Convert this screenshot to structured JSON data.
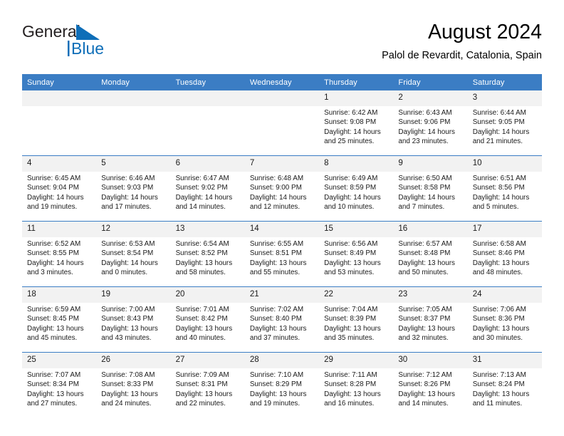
{
  "brand": {
    "name_line1": "General",
    "name_line2": "Blue",
    "logo_icon": "triangle-flag-icon",
    "color_dark": "#231f20",
    "color_blue": "#0e6eb8"
  },
  "header": {
    "title": "August 2024",
    "subtitle": "Palol de Revardit, Catalonia, Spain"
  },
  "theme": {
    "header_bg": "#3b7dc4",
    "header_text": "#ffffff",
    "daynum_bg": "#f2f2f2",
    "cell_bg": "#ffffff",
    "row_divider": "#3b7dc4",
    "body_text": "#1a1a1a"
  },
  "calendar": {
    "columns": [
      "Sunday",
      "Monday",
      "Tuesday",
      "Wednesday",
      "Thursday",
      "Friday",
      "Saturday"
    ],
    "weeks": [
      [
        {
          "day": "",
          "empty": true,
          "sunrise": "",
          "sunset": "",
          "daylight1": "",
          "daylight2": ""
        },
        {
          "day": "",
          "empty": true,
          "sunrise": "",
          "sunset": "",
          "daylight1": "",
          "daylight2": ""
        },
        {
          "day": "",
          "empty": true,
          "sunrise": "",
          "sunset": "",
          "daylight1": "",
          "daylight2": ""
        },
        {
          "day": "",
          "empty": true,
          "sunrise": "",
          "sunset": "",
          "daylight1": "",
          "daylight2": ""
        },
        {
          "day": "1",
          "empty": false,
          "sunrise": "Sunrise: 6:42 AM",
          "sunset": "Sunset: 9:08 PM",
          "daylight1": "Daylight: 14 hours",
          "daylight2": "and 25 minutes."
        },
        {
          "day": "2",
          "empty": false,
          "sunrise": "Sunrise: 6:43 AM",
          "sunset": "Sunset: 9:06 PM",
          "daylight1": "Daylight: 14 hours",
          "daylight2": "and 23 minutes."
        },
        {
          "day": "3",
          "empty": false,
          "sunrise": "Sunrise: 6:44 AM",
          "sunset": "Sunset: 9:05 PM",
          "daylight1": "Daylight: 14 hours",
          "daylight2": "and 21 minutes."
        }
      ],
      [
        {
          "day": "4",
          "empty": false,
          "sunrise": "Sunrise: 6:45 AM",
          "sunset": "Sunset: 9:04 PM",
          "daylight1": "Daylight: 14 hours",
          "daylight2": "and 19 minutes."
        },
        {
          "day": "5",
          "empty": false,
          "sunrise": "Sunrise: 6:46 AM",
          "sunset": "Sunset: 9:03 PM",
          "daylight1": "Daylight: 14 hours",
          "daylight2": "and 17 minutes."
        },
        {
          "day": "6",
          "empty": false,
          "sunrise": "Sunrise: 6:47 AM",
          "sunset": "Sunset: 9:02 PM",
          "daylight1": "Daylight: 14 hours",
          "daylight2": "and 14 minutes."
        },
        {
          "day": "7",
          "empty": false,
          "sunrise": "Sunrise: 6:48 AM",
          "sunset": "Sunset: 9:00 PM",
          "daylight1": "Daylight: 14 hours",
          "daylight2": "and 12 minutes."
        },
        {
          "day": "8",
          "empty": false,
          "sunrise": "Sunrise: 6:49 AM",
          "sunset": "Sunset: 8:59 PM",
          "daylight1": "Daylight: 14 hours",
          "daylight2": "and 10 minutes."
        },
        {
          "day": "9",
          "empty": false,
          "sunrise": "Sunrise: 6:50 AM",
          "sunset": "Sunset: 8:58 PM",
          "daylight1": "Daylight: 14 hours",
          "daylight2": "and 7 minutes."
        },
        {
          "day": "10",
          "empty": false,
          "sunrise": "Sunrise: 6:51 AM",
          "sunset": "Sunset: 8:56 PM",
          "daylight1": "Daylight: 14 hours",
          "daylight2": "and 5 minutes."
        }
      ],
      [
        {
          "day": "11",
          "empty": false,
          "sunrise": "Sunrise: 6:52 AM",
          "sunset": "Sunset: 8:55 PM",
          "daylight1": "Daylight: 14 hours",
          "daylight2": "and 3 minutes."
        },
        {
          "day": "12",
          "empty": false,
          "sunrise": "Sunrise: 6:53 AM",
          "sunset": "Sunset: 8:54 PM",
          "daylight1": "Daylight: 14 hours",
          "daylight2": "and 0 minutes."
        },
        {
          "day": "13",
          "empty": false,
          "sunrise": "Sunrise: 6:54 AM",
          "sunset": "Sunset: 8:52 PM",
          "daylight1": "Daylight: 13 hours",
          "daylight2": "and 58 minutes."
        },
        {
          "day": "14",
          "empty": false,
          "sunrise": "Sunrise: 6:55 AM",
          "sunset": "Sunset: 8:51 PM",
          "daylight1": "Daylight: 13 hours",
          "daylight2": "and 55 minutes."
        },
        {
          "day": "15",
          "empty": false,
          "sunrise": "Sunrise: 6:56 AM",
          "sunset": "Sunset: 8:49 PM",
          "daylight1": "Daylight: 13 hours",
          "daylight2": "and 53 minutes."
        },
        {
          "day": "16",
          "empty": false,
          "sunrise": "Sunrise: 6:57 AM",
          "sunset": "Sunset: 8:48 PM",
          "daylight1": "Daylight: 13 hours",
          "daylight2": "and 50 minutes."
        },
        {
          "day": "17",
          "empty": false,
          "sunrise": "Sunrise: 6:58 AM",
          "sunset": "Sunset: 8:46 PM",
          "daylight1": "Daylight: 13 hours",
          "daylight2": "and 48 minutes."
        }
      ],
      [
        {
          "day": "18",
          "empty": false,
          "sunrise": "Sunrise: 6:59 AM",
          "sunset": "Sunset: 8:45 PM",
          "daylight1": "Daylight: 13 hours",
          "daylight2": "and 45 minutes."
        },
        {
          "day": "19",
          "empty": false,
          "sunrise": "Sunrise: 7:00 AM",
          "sunset": "Sunset: 8:43 PM",
          "daylight1": "Daylight: 13 hours",
          "daylight2": "and 43 minutes."
        },
        {
          "day": "20",
          "empty": false,
          "sunrise": "Sunrise: 7:01 AM",
          "sunset": "Sunset: 8:42 PM",
          "daylight1": "Daylight: 13 hours",
          "daylight2": "and 40 minutes."
        },
        {
          "day": "21",
          "empty": false,
          "sunrise": "Sunrise: 7:02 AM",
          "sunset": "Sunset: 8:40 PM",
          "daylight1": "Daylight: 13 hours",
          "daylight2": "and 37 minutes."
        },
        {
          "day": "22",
          "empty": false,
          "sunrise": "Sunrise: 7:04 AM",
          "sunset": "Sunset: 8:39 PM",
          "daylight1": "Daylight: 13 hours",
          "daylight2": "and 35 minutes."
        },
        {
          "day": "23",
          "empty": false,
          "sunrise": "Sunrise: 7:05 AM",
          "sunset": "Sunset: 8:37 PM",
          "daylight1": "Daylight: 13 hours",
          "daylight2": "and 32 minutes."
        },
        {
          "day": "24",
          "empty": false,
          "sunrise": "Sunrise: 7:06 AM",
          "sunset": "Sunset: 8:36 PM",
          "daylight1": "Daylight: 13 hours",
          "daylight2": "and 30 minutes."
        }
      ],
      [
        {
          "day": "25",
          "empty": false,
          "sunrise": "Sunrise: 7:07 AM",
          "sunset": "Sunset: 8:34 PM",
          "daylight1": "Daylight: 13 hours",
          "daylight2": "and 27 minutes."
        },
        {
          "day": "26",
          "empty": false,
          "sunrise": "Sunrise: 7:08 AM",
          "sunset": "Sunset: 8:33 PM",
          "daylight1": "Daylight: 13 hours",
          "daylight2": "and 24 minutes."
        },
        {
          "day": "27",
          "empty": false,
          "sunrise": "Sunrise: 7:09 AM",
          "sunset": "Sunset: 8:31 PM",
          "daylight1": "Daylight: 13 hours",
          "daylight2": "and 22 minutes."
        },
        {
          "day": "28",
          "empty": false,
          "sunrise": "Sunrise: 7:10 AM",
          "sunset": "Sunset: 8:29 PM",
          "daylight1": "Daylight: 13 hours",
          "daylight2": "and 19 minutes."
        },
        {
          "day": "29",
          "empty": false,
          "sunrise": "Sunrise: 7:11 AM",
          "sunset": "Sunset: 8:28 PM",
          "daylight1": "Daylight: 13 hours",
          "daylight2": "and 16 minutes."
        },
        {
          "day": "30",
          "empty": false,
          "sunrise": "Sunrise: 7:12 AM",
          "sunset": "Sunset: 8:26 PM",
          "daylight1": "Daylight: 13 hours",
          "daylight2": "and 14 minutes."
        },
        {
          "day": "31",
          "empty": false,
          "sunrise": "Sunrise: 7:13 AM",
          "sunset": "Sunset: 8:24 PM",
          "daylight1": "Daylight: 13 hours",
          "daylight2": "and 11 minutes."
        }
      ]
    ]
  }
}
